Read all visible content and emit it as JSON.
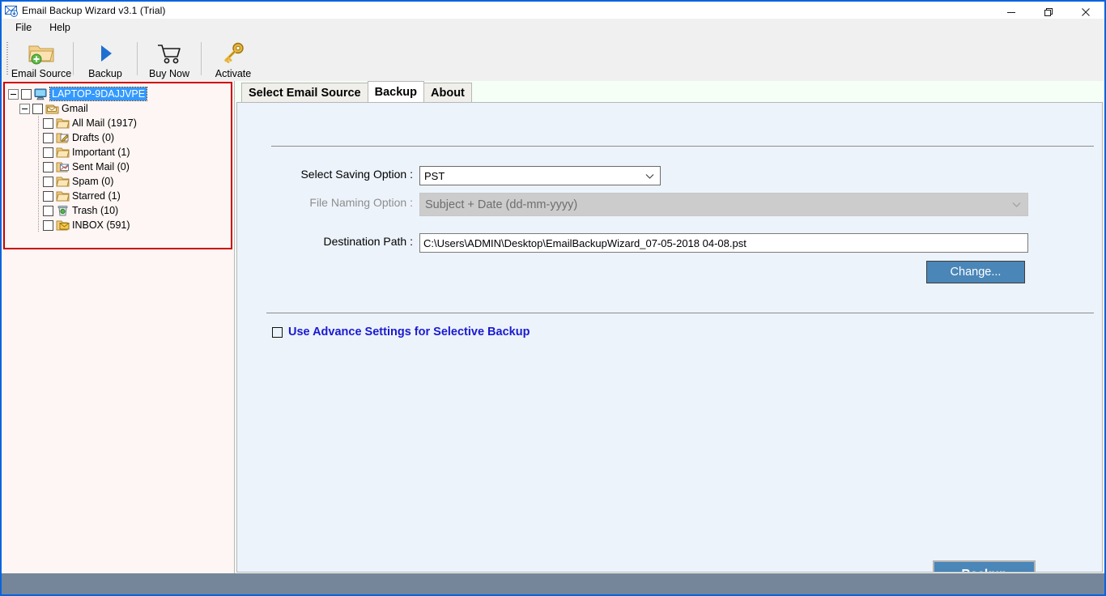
{
  "window": {
    "title": "Email Backup Wizard v3.1 (Trial)",
    "app_icon": "envelope-download-icon",
    "controls": {
      "minimize": "minimize-icon",
      "maximize": "maximize-icon",
      "close": "close-icon"
    }
  },
  "menubar": {
    "items": [
      {
        "label": "File"
      },
      {
        "label": "Help"
      }
    ]
  },
  "toolbar": {
    "buttons": [
      {
        "label": "Email Source",
        "icon": "folder-add-icon"
      },
      {
        "label": "Backup",
        "icon": "play-triangle-icon"
      },
      {
        "label": "Buy Now",
        "icon": "shopping-cart-icon"
      },
      {
        "label": "Activate",
        "icon": "key-icon"
      }
    ]
  },
  "tree": {
    "root": {
      "label": "LAPTOP-9DAJJVPE",
      "icon": "computer-icon",
      "selected": true,
      "expanded": true
    },
    "account": {
      "label": "Gmail",
      "icon": "mail-stack-icon",
      "expanded": true
    },
    "folders": [
      {
        "label": "All Mail (1917)",
        "icon": "folder-icon"
      },
      {
        "label": "Drafts (0)",
        "icon": "folder-draft-icon"
      },
      {
        "label": "Important (1)",
        "icon": "folder-icon"
      },
      {
        "label": "Sent Mail (0)",
        "icon": "folder-sent-icon"
      },
      {
        "label": "Spam (0)",
        "icon": "folder-icon"
      },
      {
        "label": "Starred (1)",
        "icon": "folder-icon"
      },
      {
        "label": "Trash (10)",
        "icon": "trash-icon"
      },
      {
        "label": "INBOX (591)",
        "icon": "folder-inbox-icon"
      }
    ]
  },
  "tabs": [
    {
      "label": "Select Email Source",
      "active": false
    },
    {
      "label": "Backup",
      "active": true
    },
    {
      "label": "About",
      "active": false
    }
  ],
  "form": {
    "saving_option": {
      "label": "Select Saving Option :",
      "value": "PST",
      "enabled": true
    },
    "file_naming": {
      "label": "File Naming Option :",
      "value": "Subject + Date (dd-mm-yyyy)",
      "enabled": false
    },
    "destination": {
      "label": "Destination Path :",
      "value": "C:\\Users\\ADMIN\\Desktop\\EmailBackupWizard_07-05-2018 04-08.pst"
    },
    "change_button": "Change...",
    "advance_settings": {
      "label": "Use Advance Settings for Selective Backup",
      "checked": false
    },
    "backup_button": "Backup"
  },
  "colors": {
    "accent_button": "#4a86b8",
    "tree_highlight": "#3399ff",
    "panel_bg": "#ecf3fb",
    "left_bg": "#fdf6f4",
    "red_outline": "#cc0000",
    "link_blue": "#1a1ad0",
    "statusbar": "#76869a",
    "window_border": "#0a64dc"
  }
}
